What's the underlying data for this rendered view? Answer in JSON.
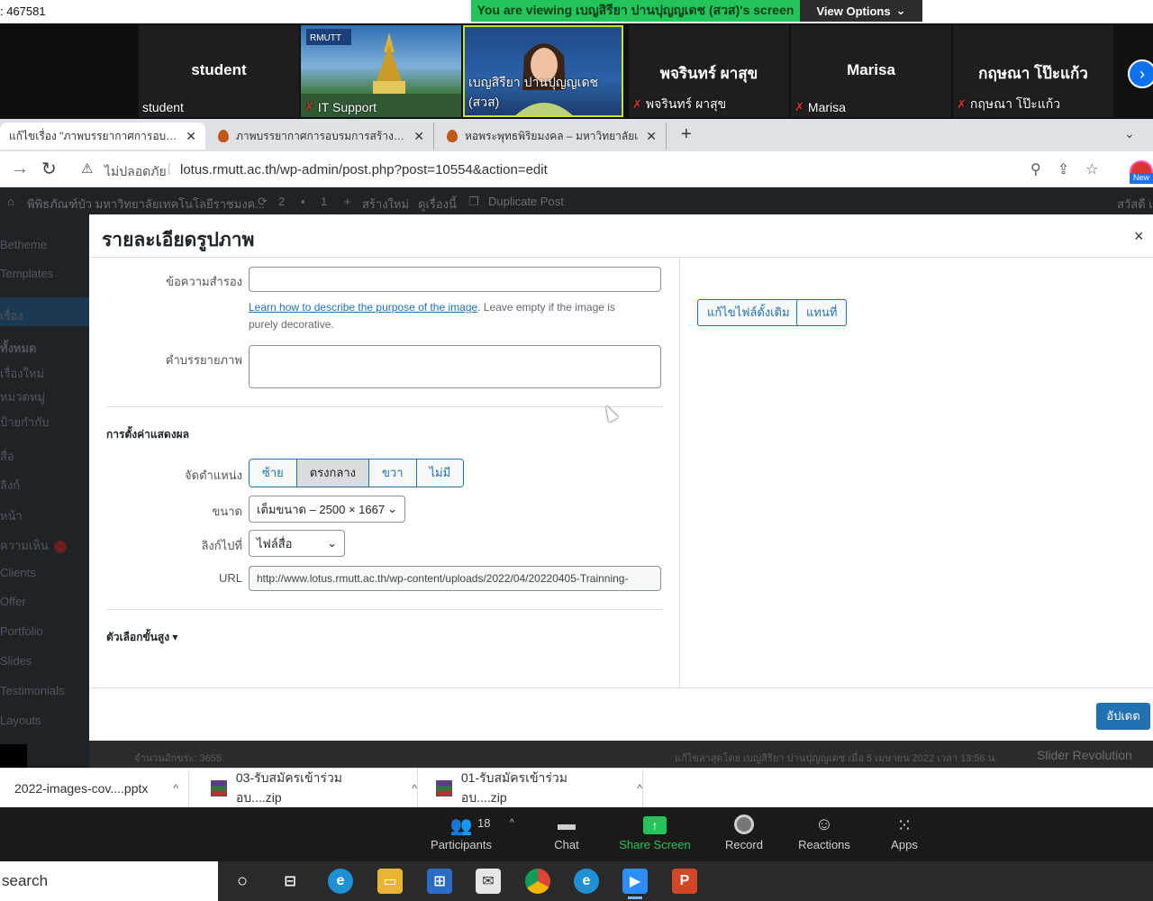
{
  "zoom": {
    "meeting_id": ": 467581",
    "viewing_banner": "You are viewing เบญสิรียา ปานปุญญเดช (สวส)'s screen",
    "view_options": "View Options",
    "participants_tiles": [
      {
        "big_name": "student",
        "label": "student",
        "muted": false
      },
      {
        "big_name": "",
        "label": "IT Support",
        "muted": true
      },
      {
        "big_name": "",
        "label": "เบญสิรียา ปานปุญญเดช (สวส)",
        "muted": false
      },
      {
        "big_name": "พจรินทร์ ผาสุข",
        "label": "พจรินทร์ ผาสุข",
        "muted": true
      },
      {
        "big_name": "Marisa",
        "label": "Marisa",
        "muted": true
      },
      {
        "big_name": "กฤษณา โป๊ะแก้ว",
        "label": "กฤษณา โป๊ะแก้ว",
        "muted": true
      }
    ],
    "toolbar": {
      "participants_label": "Participants",
      "participants_count": "18",
      "chat_label": "Chat",
      "share_label": "Share Screen",
      "record_label": "Record",
      "reactions_label": "Reactions",
      "apps_label": "Apps"
    },
    "colors": {
      "banner": "#23c45a",
      "active_tile_border": "#c8e22a",
      "accent": "#0e72ed"
    }
  },
  "browser": {
    "tabs": [
      {
        "title": "แก้ไขเรื่อง \"ภาพบรรยากาศการอบรมเ",
        "active": true
      },
      {
        "title": "ภาพบรรยากาศการอบรมการสร้างอินโฟ",
        "active": false
      },
      {
        "title": "หอพระพุทธพิริยมงคล – มหาวิทยาลัยเ",
        "active": false
      }
    ],
    "not_secure_label": "ไม่ปลอดภัย",
    "url": "lotus.rmutt.ac.th/wp-admin/post.php?post=10554&action=edit",
    "profile_badge": "New"
  },
  "wp_admin_bar": {
    "site_name": "พิพิธภัณฑ์บัว มหาวิทยาลัยเทคโนโลยีราชมงค...",
    "updates": "2",
    "comments": "1",
    "new_label": "สร้างใหม่",
    "view_label": "ดูเรื่องนี้",
    "duplicate_label": "Duplicate Post",
    "greeting": "สวัสดี เ"
  },
  "wp_sidebar": {
    "items": [
      "Betheme",
      "Templates",
      "เรื่อง",
      "ทั้งหมด",
      "เรื่องใหม่",
      "หมวดหมู่",
      "ป้ายกำกับ",
      "สื่อ",
      "ลิงก์",
      "หน้า",
      "ความเห็น",
      "Clients",
      "Offer",
      "Portfolio",
      "Slides",
      "Testimonials",
      "Layouts"
    ],
    "comment_badge": "1"
  },
  "modal": {
    "title": "รายละเอียดรูปภาพ",
    "close": "×",
    "alt_label": "ข้อความสำรอง",
    "alt_value": "",
    "alt_help_link": "Learn how to describe the purpose of the image",
    "alt_help_rest": ". Leave empty if the image is purely decorative.",
    "caption_label": "คำบรรยายภาพ",
    "caption_value": "",
    "display_section": "การตั้งค่าแสดงผล",
    "align_label": "จัดตำแหน่ง",
    "align_options": [
      "ซ้าย",
      "ตรงกลาง",
      "ขวา",
      "ไม่มี"
    ],
    "align_selected": "ตรงกลาง",
    "size_label": "ขนาด",
    "size_value": "เต็มขนาด – 2500 × 1667",
    "link_label": "ลิงก์ไปที่",
    "link_value": "ไฟล์สื่อ",
    "url_label": "URL",
    "url_value": "http://www.lotus.rmutt.ac.th/wp-content/uploads/2022/04/20220405-Trainning-",
    "advanced_label": "ตัวเลือกขั้นสูง",
    "edit_original_button": "แก้ไขไฟล์ดั้งเดิม",
    "replace_button": "แทนที่",
    "update_button": "อัปเดต"
  },
  "wp_footer": {
    "word_count": "จำนวนอักขระ: 3655",
    "last_modified": "แก้ไขล่าสุดโดย เบญสิรียา ปานปุญญเดช เมื่อ 5 เมษายน 2022 เวลา 13:56 น.",
    "slider_box": "Slider Revolution"
  },
  "downloads": [
    {
      "name": "2022-images-cov....pptx"
    },
    {
      "name": "03-รับสมัครเข้าร่วมอบ....zip"
    },
    {
      "name": "01-รับสมัครเข้าร่วมอบ....zip"
    }
  ],
  "taskbar": {
    "search_text": "search",
    "apps": [
      "cortana-icon",
      "task-view-icon",
      "edge-icon",
      "file-explorer-icon",
      "store-icon",
      "mail-icon",
      "chrome-icon",
      "edge-icon",
      "zoom-icon",
      "powerpoint-icon"
    ]
  }
}
